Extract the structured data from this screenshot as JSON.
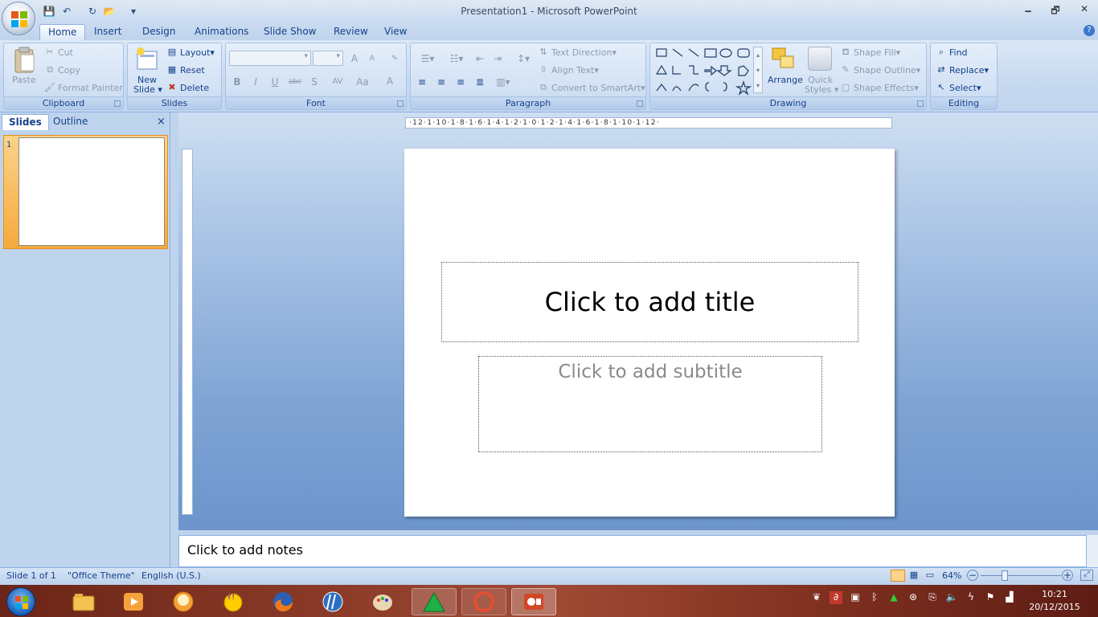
{
  "window": {
    "title": "Presentation1 - Microsoft PowerPoint",
    "minimize": "🗕",
    "maximize": "🗗",
    "close": "✕"
  },
  "qat": {
    "save": "💾",
    "undo": "↶",
    "redo": "↻",
    "open": "📂",
    "customize": "▾"
  },
  "tabs": [
    "Home",
    "Insert",
    "Design",
    "Animations",
    "Slide Show",
    "Review",
    "View"
  ],
  "help": "?",
  "ribbon": {
    "clipboard": {
      "label": "Clipboard",
      "paste": "Paste",
      "cut": "Cut",
      "copy": "Copy",
      "format_painter": "Format Painter"
    },
    "slides": {
      "label": "Slides",
      "new_slide_1": "New",
      "new_slide_2": "Slide",
      "layout": "Layout",
      "reset": "Reset",
      "delete": "Delete"
    },
    "font": {
      "label": "Font",
      "font_name": "",
      "font_size": "",
      "bold": "B",
      "italic": "I",
      "underline": "U",
      "strike": "abc",
      "shadow": "S",
      "spacing": "AV",
      "case": "Aa",
      "color": "A",
      "grow": "A",
      "shrink": "A"
    },
    "paragraph": {
      "label": "Paragraph",
      "text_direction": "Text Direction",
      "align_text": "Align Text",
      "convert": "Convert to SmartArt"
    },
    "drawing": {
      "label": "Drawing",
      "arrange": "Arrange",
      "quick_1": "Quick",
      "quick_2": "Styles",
      "shape_fill": "Shape Fill",
      "shape_outline": "Shape Outline",
      "shape_effects": "Shape Effects"
    },
    "editing": {
      "label": "Editing",
      "find": "Find",
      "replace": "Replace",
      "select": "Select"
    }
  },
  "panes": {
    "slides_tab": "Slides",
    "outline_tab": "Outline",
    "close": "×",
    "slide_number": "1"
  },
  "ruler": {
    "h": "·12·1·10·1·8·1·6·1·4·1·2·1·0·1·2·1·4·1·6·1·8·1·10·1·12·"
  },
  "slide": {
    "title_placeholder": "Click to add title",
    "subtitle_placeholder": "Click to add subtitle"
  },
  "notes": {
    "placeholder": "Click to add notes"
  },
  "status": {
    "slide": "Slide 1 of 1",
    "theme": "\"Office Theme\"",
    "language": "English (U.S.)",
    "zoom": "64%",
    "zoom_out": "−",
    "zoom_in": "+"
  },
  "clock": {
    "time": "10:21",
    "date": "20/12/2015"
  }
}
